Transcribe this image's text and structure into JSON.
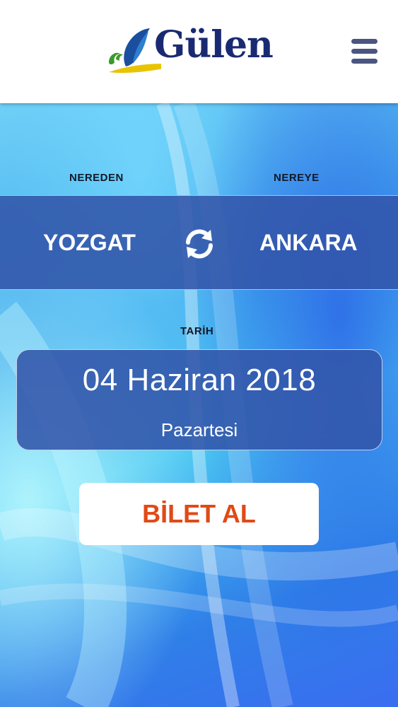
{
  "header": {
    "logo_text": "Gülen",
    "menu_icon": "hamburger-menu-icon"
  },
  "route": {
    "from_label": "NEREDEN",
    "to_label": "NEREYE",
    "from_city": "YOZGAT",
    "to_city": "ANKARA",
    "swap_icon": "swap-refresh-icon"
  },
  "date": {
    "label": "TARİH",
    "value": "04 Haziran 2018",
    "weekday": "Pazartesi"
  },
  "actions": {
    "buy_label": "BİLET AL"
  },
  "colors": {
    "brand_navy": "#1a2a72",
    "panel_blue": "#3255aa",
    "buy_text": "#e04a16"
  }
}
